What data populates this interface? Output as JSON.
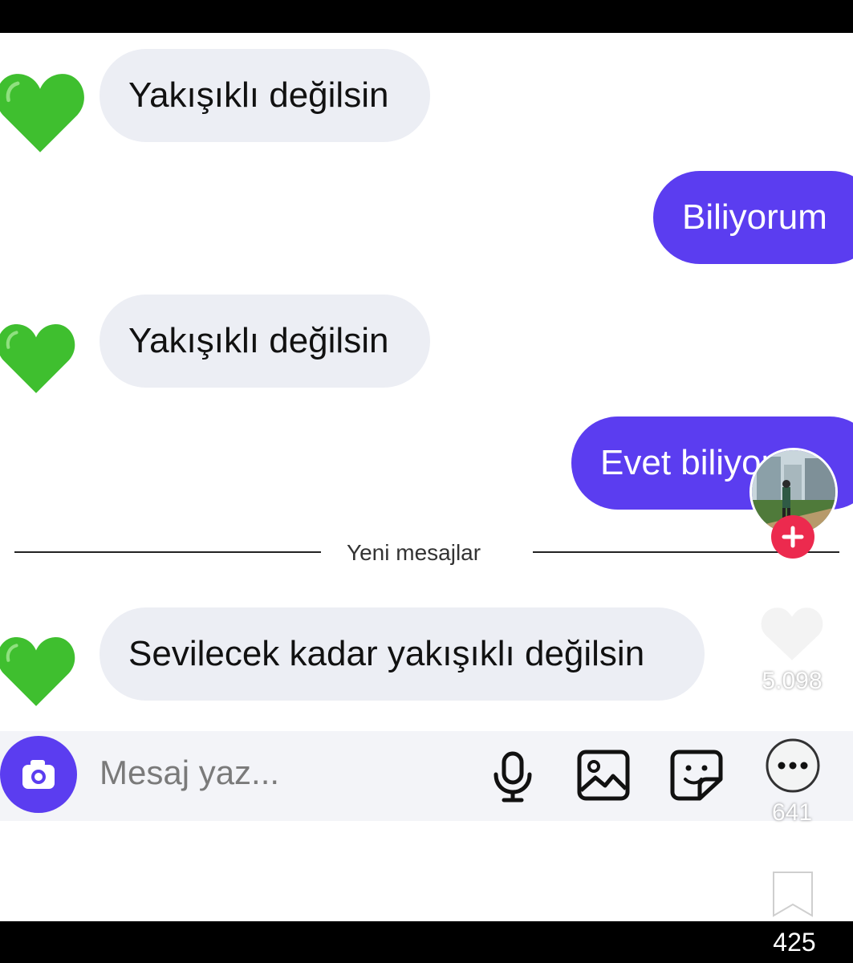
{
  "messages": [
    {
      "direction": "incoming",
      "text": "Yakışıklı değilsin"
    },
    {
      "direction": "outgoing",
      "text": "Biliyorum"
    },
    {
      "direction": "incoming",
      "text": "Yakışıklı değilsin"
    },
    {
      "direction": "outgoing",
      "text": "Evet biliyorum"
    },
    {
      "direction": "incoming",
      "text": "Sevilecek kadar yakışıklı değilsin"
    }
  ],
  "divider": {
    "label": "Yeni mesajlar"
  },
  "composer": {
    "placeholder": "Mesaj yaz...",
    "icons": [
      "camera-icon",
      "microphone-icon",
      "image-icon",
      "sticker-icon"
    ]
  },
  "overlay": {
    "like_count": "5.098",
    "comment_count": "641",
    "bookmark_count": "425"
  },
  "colors": {
    "outgoing_bubble": "#5b3df0",
    "incoming_bubble": "#eceef4",
    "heart": "#3fbf2f",
    "follow_plus": "#ec2a4e"
  }
}
